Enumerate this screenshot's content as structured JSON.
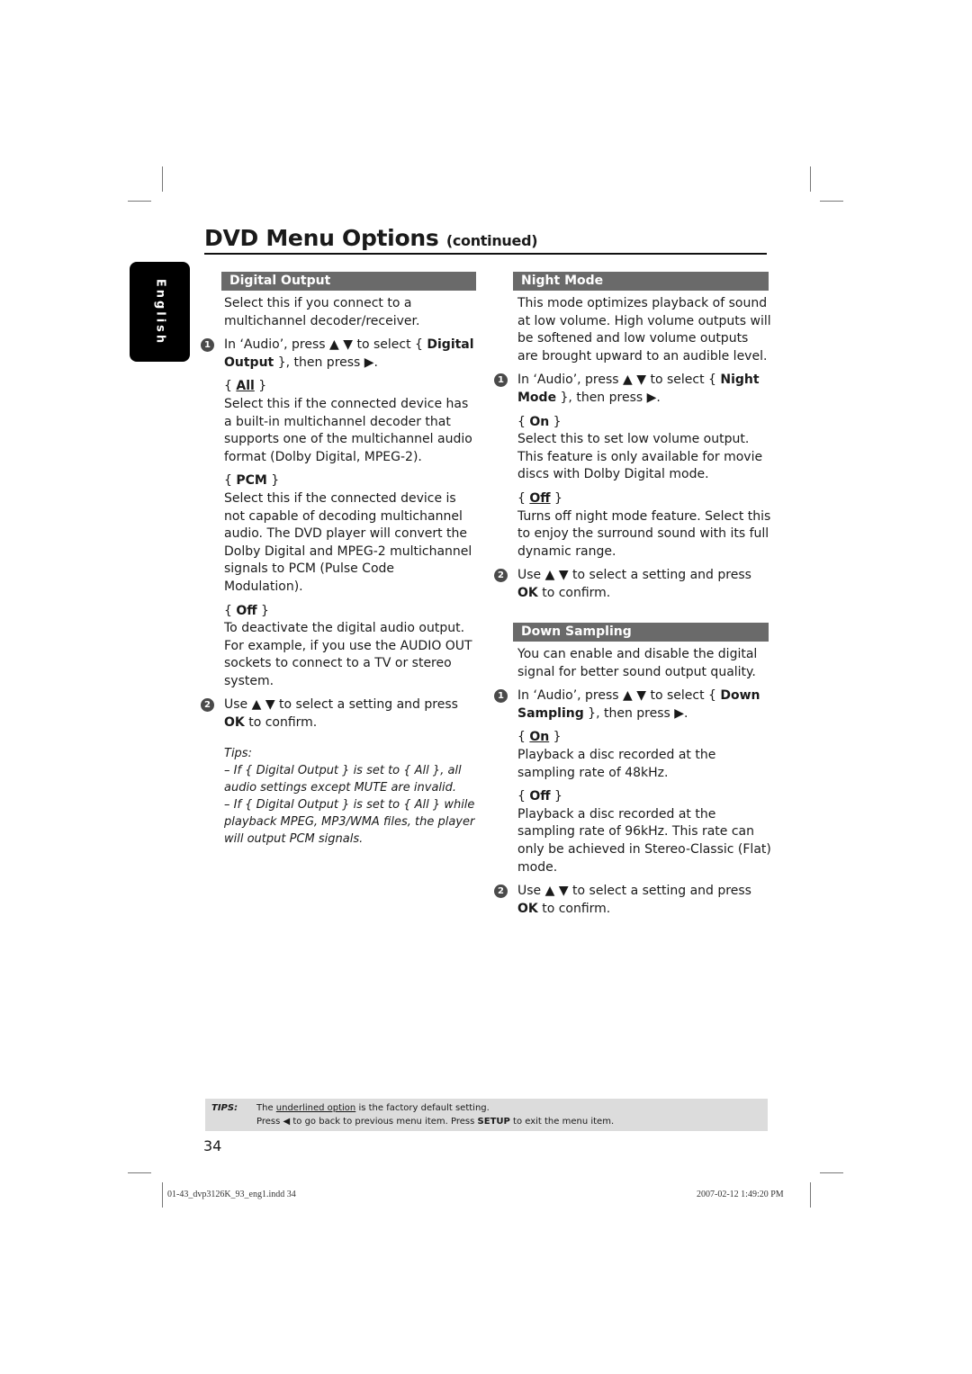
{
  "title": {
    "main": "DVD Menu Options",
    "continued": "(continued)"
  },
  "language_tab": "English",
  "left_column": {
    "header": "Digital Output",
    "intro": "Select this if you connect to a multichannel decoder/receiver.",
    "step1": {
      "num": "1",
      "pre": "In ‘Audio’, press ▲ ▼ to select { ",
      "bold": "Digital Output",
      "post": " }, then press ▶."
    },
    "options": [
      {
        "label": "All",
        "underlined": true,
        "desc": "Select this if the connected device has a built-in multichannel decoder that supports one of the multichannel audio format (Dolby Digital, MPEG-2)."
      },
      {
        "label": "PCM",
        "underlined": false,
        "desc": "Select this if the connected device is not capable of decoding multichannel audio. The DVD player will convert the Dolby Digital and MPEG-2 multichannel signals to PCM (Pulse Code Modulation)."
      },
      {
        "label": "Off",
        "underlined": false,
        "desc": "To deactivate the digital audio output. For example, if you use the AUDIO OUT sockets to connect to a TV or stereo system."
      }
    ],
    "step2": {
      "num": "2",
      "pre": "Use ▲ ▼ to select a setting and press ",
      "bold": "OK",
      "post": " to confirm."
    },
    "tips_title": "Tips:",
    "tips": [
      "– If { Digital Output } is set to { All }, all audio settings except MUTE are invalid.",
      "– If { Digital Output } is set to { All } while playback MPEG, MP3/WMA files, the player will output PCM signals."
    ]
  },
  "night_mode": {
    "header": "Night Mode",
    "intro": "This mode optimizes playback of sound at low volume. High volume outputs will be softened and low volume outputs are brought upward to an audible level.",
    "step1": {
      "num": "1",
      "pre": "In ‘Audio’, press ▲ ▼ to select { ",
      "bold": "Night Mode",
      "post": " }, then press ▶."
    },
    "options": [
      {
        "label": "On",
        "underlined": false,
        "desc": "Select this to set low volume output. This feature is only available for movie discs with Dolby Digital mode."
      },
      {
        "label": "Off",
        "underlined": true,
        "desc": "Turns off night mode feature. Select this to enjoy the surround sound with its full dynamic range."
      }
    ],
    "step2": {
      "num": "2",
      "pre": "Use ▲ ▼ to select a setting and press ",
      "bold": "OK",
      "post": " to confirm."
    }
  },
  "down_sampling": {
    "header": "Down Sampling",
    "intro": "You can enable and disable the digital signal for better sound output quality.",
    "step1": {
      "num": "1",
      "pre": "In ‘Audio’, press ▲ ▼ to select { ",
      "bold": "Down Sampling",
      "post": " }, then press ▶."
    },
    "options": [
      {
        "label": "On",
        "underlined": true,
        "desc": "Playback a disc recorded at the sampling rate of 48kHz."
      },
      {
        "label": "Off",
        "underlined": false,
        "desc": "Playback a disc recorded at the sampling rate of 96kHz. This rate can only be achieved in Stereo-Classic (Flat) mode."
      }
    ],
    "step2": {
      "num": "2",
      "pre": "Use ▲ ▼ to select a setting and press ",
      "bold": "OK",
      "post": " to confirm."
    }
  },
  "footer_tips": {
    "label": "TIPS:",
    "line1_pre": "The ",
    "line1_underlined": "underlined option",
    "line1_post": " is the factory default setting.",
    "line2_pre": "Press  ◀ to go back to previous menu item. Press ",
    "line2_bold": "SETUP",
    "line2_post": " to exit the menu item."
  },
  "page_number": "34",
  "slug": {
    "file": "01-43_dvp3126K_93_eng1.indd   34",
    "timestamp": "2007-02-12   1:49:20 PM"
  }
}
